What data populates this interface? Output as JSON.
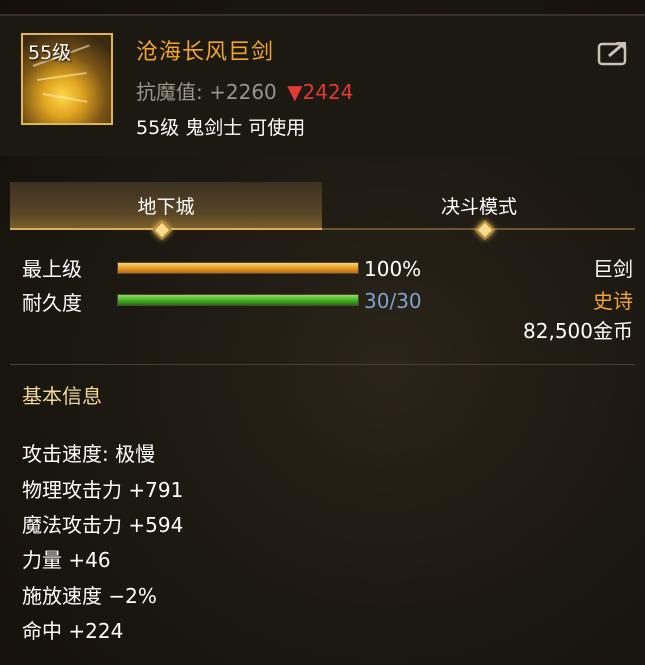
{
  "item": {
    "level_badge": "55级",
    "name": "沧海长风巨剑",
    "resist_label": "抗魔值:",
    "resist_value": "+2260",
    "resist_compare": "▼2424",
    "requirement": "55级 鬼剑士 可使用"
  },
  "tabs": [
    {
      "label": "地下城",
      "active": true
    },
    {
      "label": "决斗模式",
      "active": false
    }
  ],
  "stats": {
    "grade_label": "最上级",
    "grade_value": "100%",
    "grade_percent": 100,
    "durability_label": "耐久度",
    "durability_value": "30/30",
    "durability_percent": 100
  },
  "meta": {
    "type": "巨剑",
    "rarity": "史诗",
    "price": "82,500金币"
  },
  "basic_info": {
    "title": "基本信息",
    "lines": [
      "攻击速度: 极慢",
      "物理攻击力 +791",
      "魔法攻击力 +594",
      "力量 +46",
      "施放速度 −2%",
      "命中 +224"
    ]
  },
  "colors": {
    "rarity": "#f2a62c",
    "durability_text": "#7fa0cf",
    "down": "#e23a32"
  }
}
